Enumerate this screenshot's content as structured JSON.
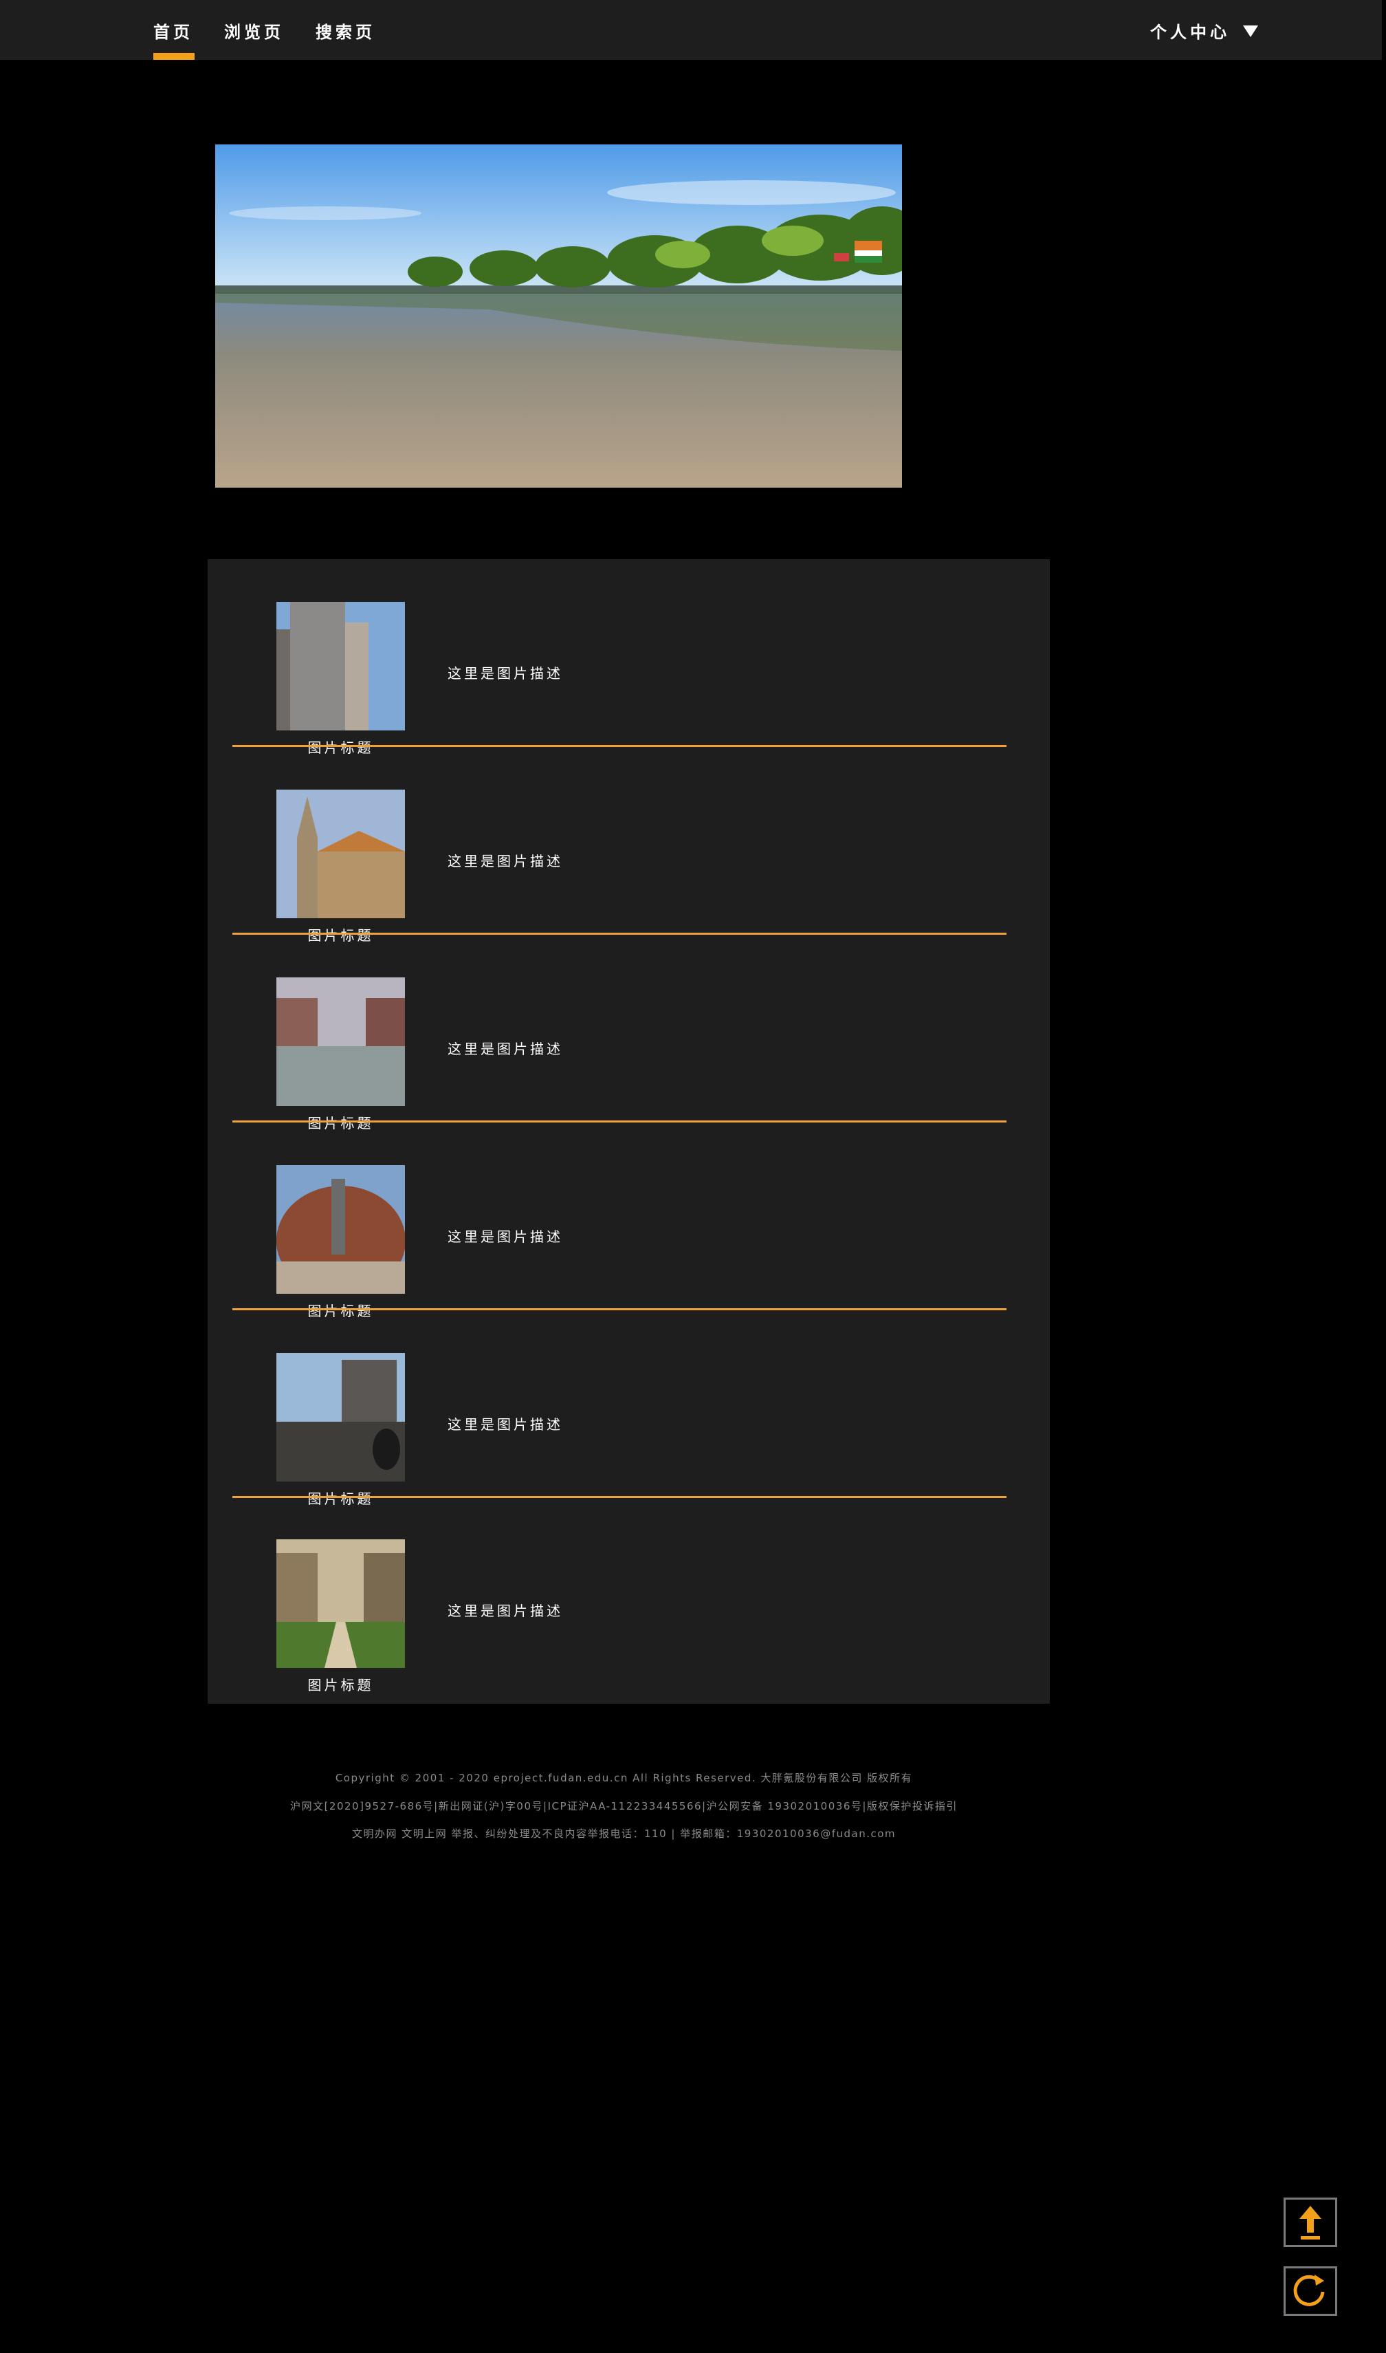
{
  "nav": {
    "items": [
      {
        "label": "首页",
        "active": true
      },
      {
        "label": "浏览页",
        "active": false
      },
      {
        "label": "搜索页",
        "active": false
      }
    ],
    "user_menu": "个人中心"
  },
  "hero": {
    "alt": "beach with palm trees"
  },
  "list": {
    "items": [
      {
        "title": "图片标题",
        "desc": "这里是图片描述"
      },
      {
        "title": "图片标题",
        "desc": "这里是图片描述"
      },
      {
        "title": "图片标题",
        "desc": "这里是图片描述"
      },
      {
        "title": "图片标题",
        "desc": "这里是图片描述"
      },
      {
        "title": "图片标题",
        "desc": "这里是图片描述"
      },
      {
        "title": "图片标题",
        "desc": "这里是图片描述"
      }
    ]
  },
  "footer": {
    "line1": "Copyright © 2001 - 2020 eproject.fudan.edu.cn All Rights Reserved. 大胖氪股份有限公司 版权所有",
    "line2": "沪网文[2020]9527-686号|新出网证(沪)字00号|ICP证沪AA-112233445566|沪公网安备 19302010036号|版权保护投诉指引",
    "line3": "文明办网 文明上网 举报、纠纷处理及不良内容举报电话：110 | 举报邮箱：19302010036@fudan.com"
  },
  "colors": {
    "accent": "#f5a01a",
    "nav_bg": "#1e1e1e",
    "panel_bg": "#1e1e1e",
    "page_bg": "#000000"
  },
  "icons": {
    "back_to_top": "arrow-up-icon",
    "refresh": "refresh-icon",
    "user_menu_caret": "caret-down-icon"
  }
}
